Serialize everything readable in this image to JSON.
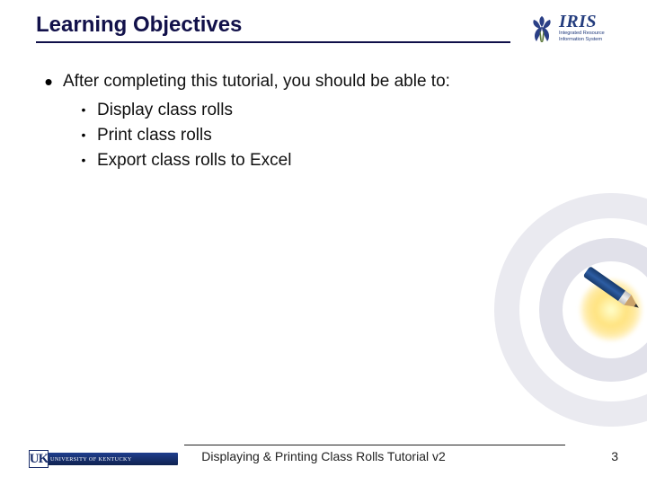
{
  "header": {
    "title": "Learning Objectives",
    "logo": {
      "name": "IRIS",
      "subtitle_line1": "Integrated Resource",
      "subtitle_line2": "Information System"
    }
  },
  "content": {
    "intro": "After completing this tutorial, you should be able to:",
    "bullets": [
      "Display class rolls",
      "Print class rolls",
      "Export class rolls to Excel"
    ]
  },
  "footer": {
    "institution": "UNIVERSITY OF KENTUCKY",
    "institution_mono": "UK",
    "doc_title": "Displaying & Printing Class Rolls Tutorial v2",
    "page_number": "3"
  }
}
